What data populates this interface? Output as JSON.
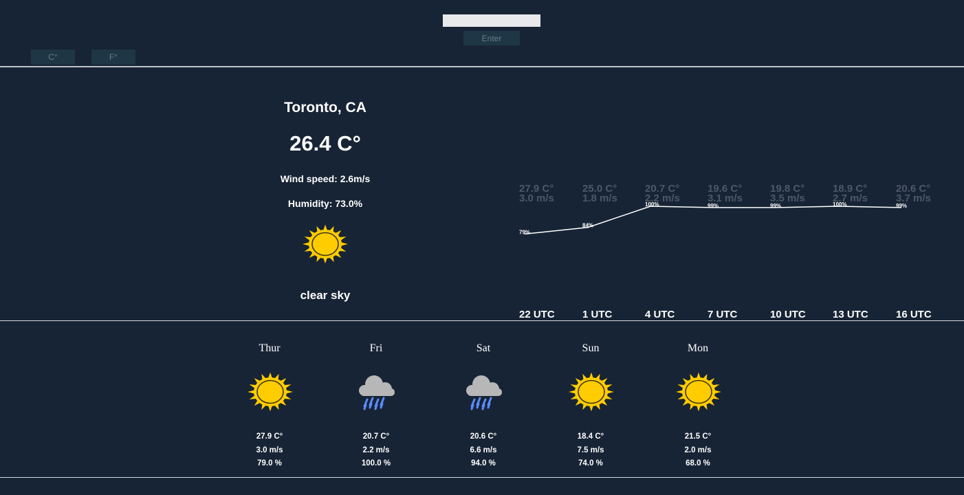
{
  "search": {
    "value": "",
    "placeholder": ""
  },
  "enter_label": "Enter",
  "units": {
    "celsius": "C°",
    "fahrenheit": "F°"
  },
  "current": {
    "city": "Toronto, CA",
    "temperature": "26.4 C°",
    "wind": "Wind speed: 2.6m/s",
    "humidity": "Humidity: 73.0%",
    "icon": "sun-icon",
    "description": "clear sky"
  },
  "chart_data": {
    "type": "line",
    "categories": [
      "22 UTC",
      "1 UTC",
      "4 UTC",
      "7 UTC",
      "10 UTC",
      "13 UTC",
      "16 UTC"
    ],
    "series": [
      {
        "values": [
          79,
          84,
          100,
          99,
          99,
          100,
          99
        ]
      }
    ],
    "value_labels": [
      "79%",
      "84%",
      "100%",
      "99%",
      "99%",
      "100%",
      "99%"
    ],
    "temps": [
      "27.9 C°",
      "25.0 C°",
      "20.7 C°",
      "19.6 C°",
      "19.8 C°",
      "18.9 C°",
      "20.6 C°"
    ],
    "winds": [
      "3.0 m/s",
      "1.8 m/s",
      "2.2 m/s",
      "3.1 m/s",
      "3.5 m/s",
      "2.7 m/s",
      "3.7 m/s"
    ],
    "ylim": [
      0,
      100
    ],
    "colors": {
      "line": "#ffffff",
      "header_text": "#4d5866",
      "label": "#ffffff"
    }
  },
  "forecast": [
    {
      "day": "Thur",
      "icon": "sun-icon",
      "temp": "27.9 C°",
      "wind": "3.0 m/s",
      "humidity": "79.0 %"
    },
    {
      "day": "Fri",
      "icon": "rain-cloud-icon",
      "temp": "20.7 C°",
      "wind": "2.2 m/s",
      "humidity": "100.0 %"
    },
    {
      "day": "Sat",
      "icon": "rain-cloud-icon",
      "temp": "20.6 C°",
      "wind": "6.6 m/s",
      "humidity": "94.0 %"
    },
    {
      "day": "Sun",
      "icon": "sun-icon",
      "temp": "18.4 C°",
      "wind": "7.5 m/s",
      "humidity": "74.0 %"
    },
    {
      "day": "Mon",
      "icon": "sun-icon",
      "temp": "21.5 C°",
      "wind": "2.0 m/s",
      "humidity": "68.0 %"
    }
  ],
  "colors": {
    "background": "#172435",
    "sun": "#ffcc00",
    "sun_outline": "#3a3220",
    "cloud": "#b7b7b7",
    "rain": "#5b8cff",
    "button_bg": "#1e3646"
  }
}
